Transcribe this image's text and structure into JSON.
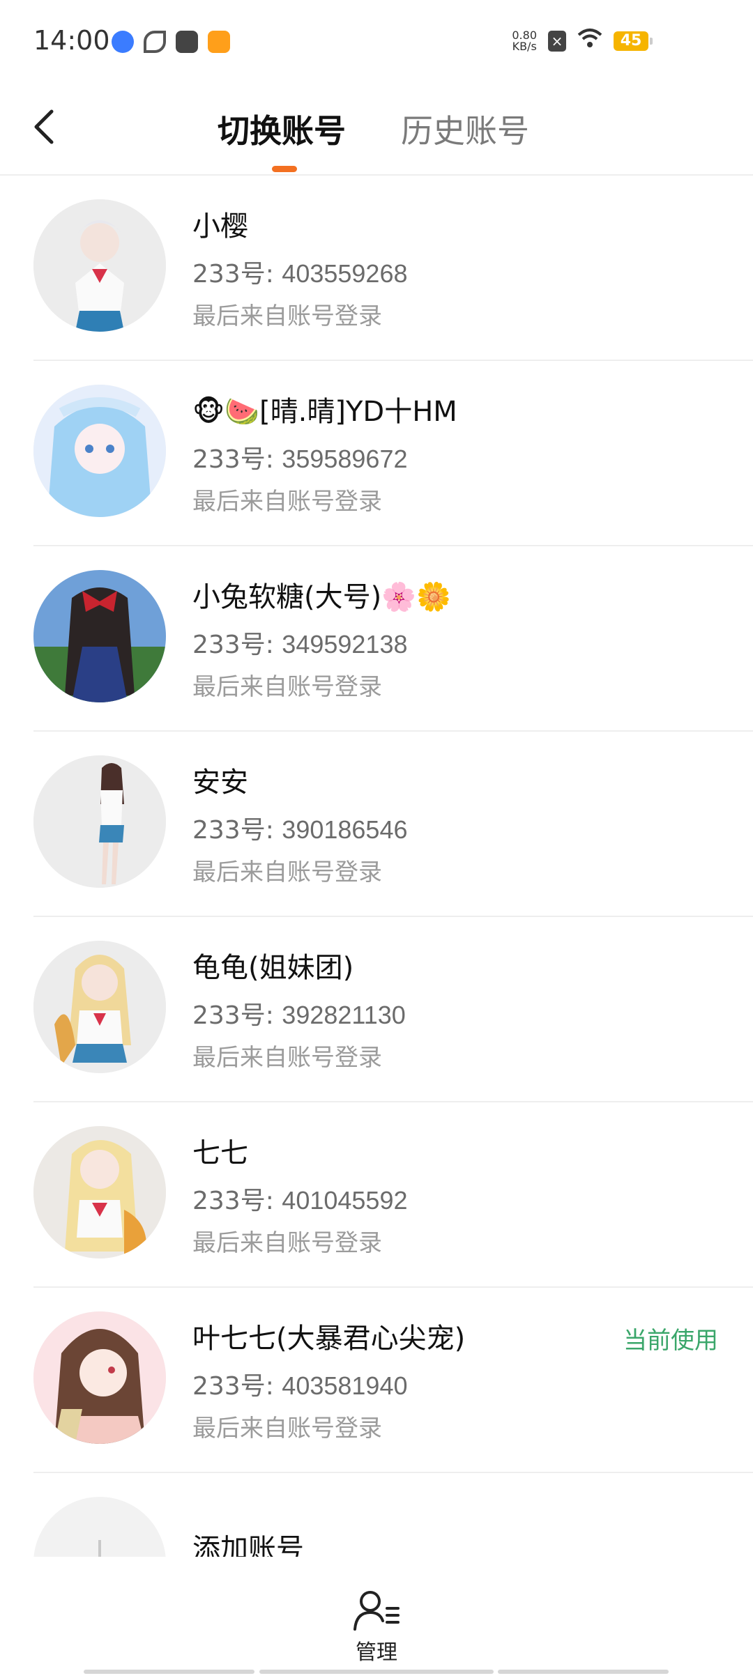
{
  "status_bar": {
    "time": "14:00",
    "net_speed_value": "0.80",
    "net_speed_unit": "KB/s",
    "battery": "45"
  },
  "header": {
    "back_icon": "chevron-left-icon",
    "tabs": [
      {
        "label": "切换账号",
        "active": true
      },
      {
        "label": "历史账号",
        "active": false
      }
    ],
    "accent_color": "#f37021"
  },
  "accounts": [
    {
      "name": "小樱",
      "id_label": "233号: ",
      "id": "403559268",
      "source": "最后来自账号登录",
      "current": ""
    },
    {
      "name": "🐵🍉[晴.晴]YD十HM",
      "id_label": "233号: ",
      "id": "359589672",
      "source": "最后来自账号登录",
      "current": ""
    },
    {
      "name": "小兔软糖(大号)🌸🌼",
      "id_label": "233号: ",
      "id": "349592138",
      "source": "最后来自账号登录",
      "current": ""
    },
    {
      "name": "安安",
      "id_label": "233号: ",
      "id": "390186546",
      "source": "最后来自账号登录",
      "current": ""
    },
    {
      "name": "龟龟(姐妹团)",
      "id_label": "233号: ",
      "id": "392821130",
      "source": "最后来自账号登录",
      "current": ""
    },
    {
      "name": "七七",
      "id_label": "233号: ",
      "id": "401045592",
      "source": "最后来自账号登录",
      "current": ""
    },
    {
      "name": "叶七七(大暴君心尖宠)",
      "id_label": "233号: ",
      "id": "403581940",
      "source": "最后来自账号登录",
      "current": "当前使用"
    }
  ],
  "add_account": {
    "label": "添加账号"
  },
  "bottom_bar": {
    "manage_label": "管理",
    "manage_icon": "user-manage-icon"
  },
  "colors": {
    "current_badge": "#3aa66a"
  }
}
